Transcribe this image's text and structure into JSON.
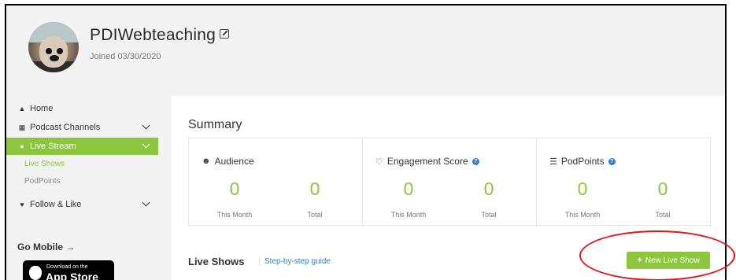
{
  "profile": {
    "username": "PDIWebteaching",
    "joined": "Joined 03/30/2020"
  },
  "sidebar": {
    "items": [
      {
        "label": "Home",
        "icon": "home-icon"
      },
      {
        "label": "Podcast Channels",
        "icon": "grid-icon"
      },
      {
        "label": "Live Stream",
        "icon": "broadcast-icon",
        "active": true
      },
      {
        "label": "Follow & Like",
        "icon": "heart-icon"
      }
    ],
    "sub_items": [
      "Live Shows",
      "PodPoints"
    ],
    "go_mobile": "Go Mobile →",
    "app_store_small": "Download on the",
    "app_store_big": "App Store"
  },
  "main": {
    "summary_title": "Summary",
    "stats": [
      {
        "title": "Audience",
        "icon": "user-icon",
        "month_value": "0",
        "total_value": "0"
      },
      {
        "title": "Engagement Score",
        "icon": "heart-outline-icon",
        "info": true,
        "month_value": "0",
        "total_value": "0"
      },
      {
        "title": "PodPoints",
        "icon": "coins-icon",
        "info": true,
        "month_value": "0",
        "total_value": "0"
      }
    ],
    "month_label": "This Month",
    "total_label": "Total",
    "live_shows_title": "Live Shows",
    "guide_link": "Step-by-step guide",
    "new_show_button": "New Live Show"
  },
  "colors": {
    "accent": "#8cc63f",
    "link": "#2e7fd0",
    "annotation": "#e8141c"
  }
}
